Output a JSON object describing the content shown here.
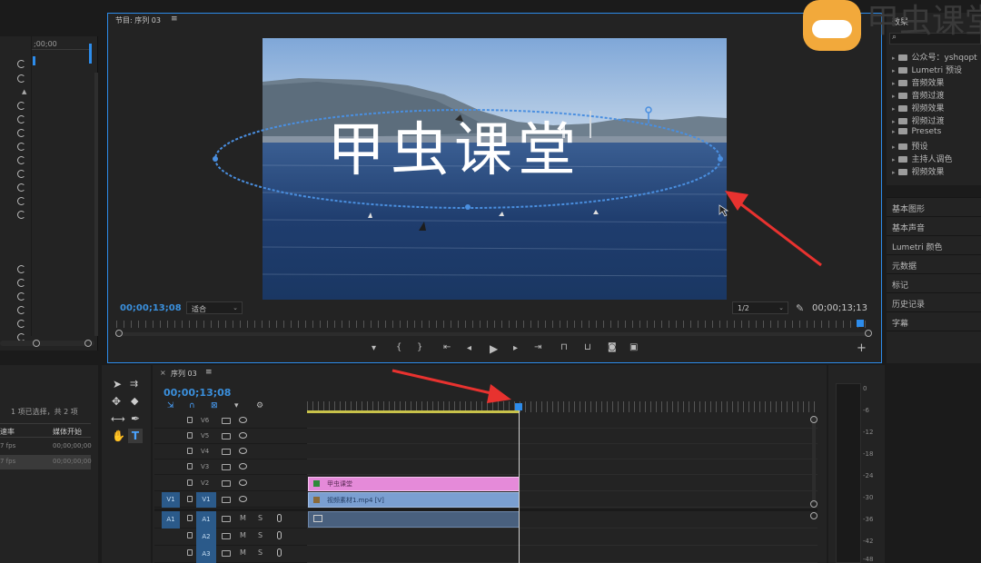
{
  "watermark": {
    "logo_text": "甲虫课堂"
  },
  "left_panel": {
    "timecode": ";00;00",
    "selection_status": "1 项已选择，共 2 项",
    "col_rate": "速率",
    "col_media_start": "媒体开始",
    "rows": [
      {
        "rate": "7 fps",
        "start": "00;00;00;00"
      },
      {
        "rate": "7 fps",
        "start": "00;00;00;00"
      }
    ]
  },
  "program_monitor": {
    "title": "节目: 序列 03",
    "menu_icon": "≡",
    "overlay_text": "甲虫课堂",
    "timecode_left": "00;00;13;08",
    "fit_label": "适合",
    "resolution_label": "1/2",
    "timecode_right": "00;00;13;13"
  },
  "effects_panel": {
    "title": "效果",
    "items": [
      "公众号：yshqopt",
      "Lumetri 预设",
      "音频效果",
      "音频过渡",
      "视频效果",
      "视频过渡",
      "Presets",
      "预设",
      "主持人调色",
      "视频效果"
    ]
  },
  "right_panels": [
    "基本图形",
    "基本声音",
    "Lumetri 颜色",
    "元数据",
    "标记",
    "历史记录",
    "字幕"
  ],
  "timeline": {
    "tab_label": "序列 03",
    "timecode": "00;00;13;08",
    "video_tracks": [
      "V6",
      "V5",
      "V4",
      "V3",
      "V2",
      "V1"
    ],
    "audio_tracks": [
      "A1",
      "A2",
      "A3"
    ],
    "source_v1": "V1",
    "source_a1": "A1",
    "m_label": "M",
    "s_label": "S",
    "clip_title": "甲虫课堂",
    "clip_video": "视频素材1.mp4 [V]"
  },
  "meters": {
    "scale": [
      "0",
      "-6",
      "-12",
      "-18",
      "-24",
      "-30",
      "-36",
      "-42",
      "-48"
    ]
  },
  "colors": {
    "accent": "#2d8ceb",
    "timecode": "#3a8fdc",
    "title_clip": "#e58ad9",
    "video_clip": "#7a9fd1",
    "arrow": "#e8322f"
  }
}
